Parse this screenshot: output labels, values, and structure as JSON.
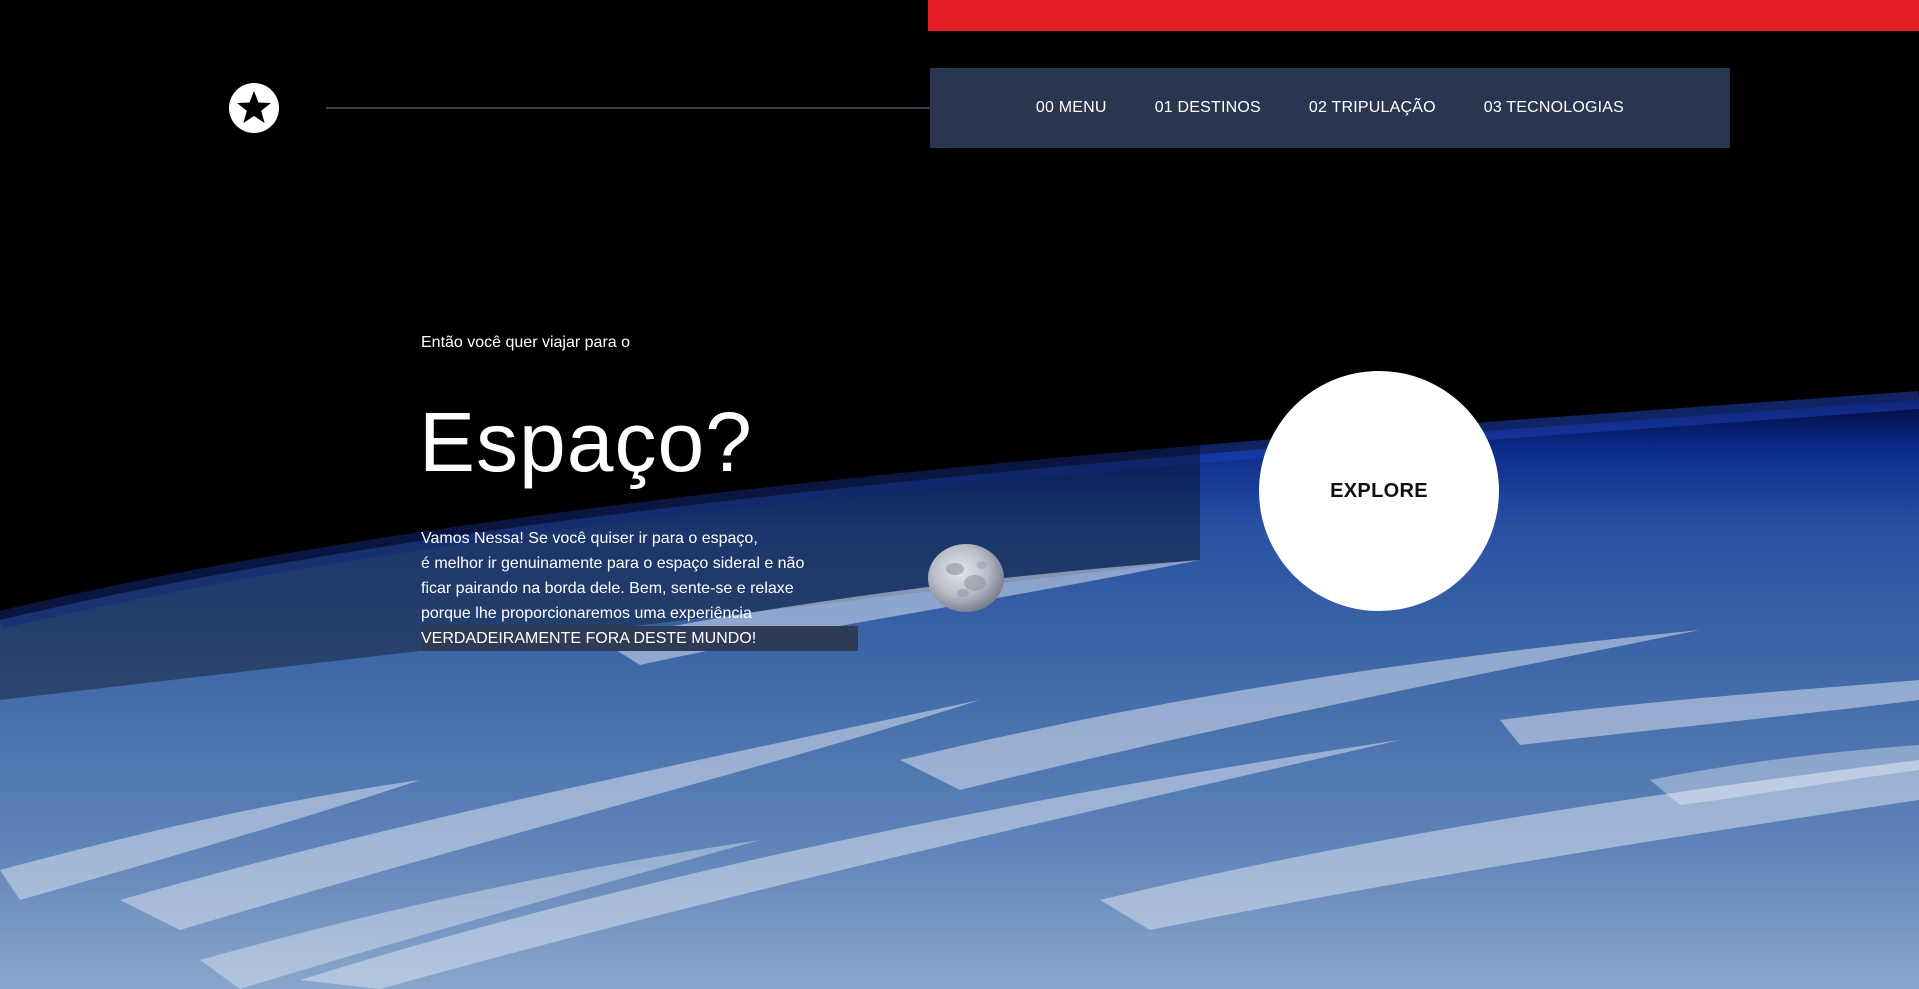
{
  "header": {
    "logo_icon": "star-circle-icon",
    "nav": [
      {
        "label": "00 MENU"
      },
      {
        "label": "01 DESTINOS"
      },
      {
        "label": "02 TRIPULAÇÃO"
      },
      {
        "label": "03 TECNOLOGIAS"
      }
    ]
  },
  "hero": {
    "intro": "Então você quer viajar para o",
    "title": "Espaço?",
    "description_lines": [
      "Vamos Nessa! Se você quiser ir para o espaço,",
      "é melhor ir genuinamente para o espaço sideral e não",
      "ficar pairando na borda dele. Bem, sente-se e relaxe",
      "porque lhe proporcionaremos uma experiência"
    ],
    "highlight": "VERDADEIRAMENTE FORA DESTE MUNDO!",
    "explore_label": "EXPLORE"
  },
  "colors": {
    "accent_bar": "#e31e24",
    "nav_background": "#2a3550",
    "highlight_background": "#2f3b56",
    "background": "#000000"
  }
}
